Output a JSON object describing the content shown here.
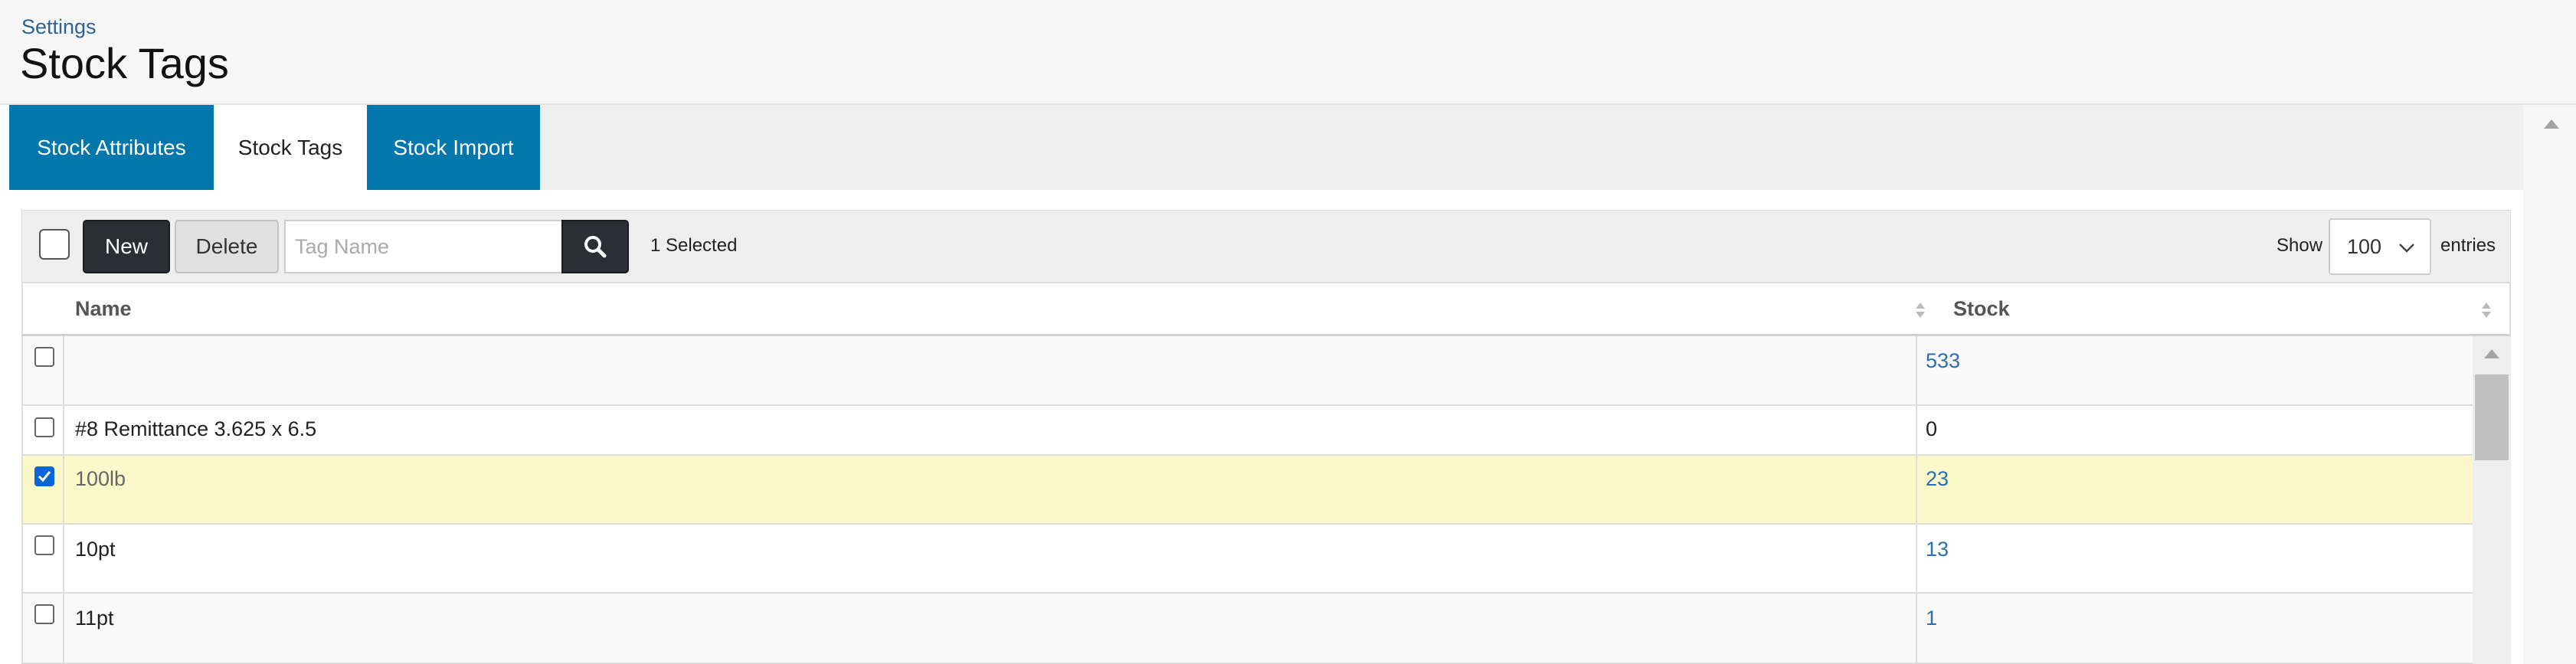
{
  "breadcrumb": "Settings",
  "page_title": "Stock Tags",
  "tabs": [
    {
      "label": "Stock Attributes",
      "active": false
    },
    {
      "label": "Stock Tags",
      "active": true
    },
    {
      "label": "Stock Import",
      "active": false
    }
  ],
  "toolbar": {
    "new_label": "New",
    "delete_label": "Delete",
    "search_placeholder": "Tag Name",
    "search_value": "",
    "selected_text": "1 Selected",
    "show_label": "Show",
    "entries_value": "100",
    "entries_label": "entries"
  },
  "table": {
    "columns": [
      "Name",
      "Stock"
    ],
    "rows": [
      {
        "name": "",
        "stock": "533",
        "checked": false
      },
      {
        "name": "#8 Remittance 3.625 x 6.5",
        "stock": "0",
        "checked": false
      },
      {
        "name": "100lb",
        "stock": "23",
        "checked": true
      },
      {
        "name": "10pt",
        "stock": "13",
        "checked": false
      },
      {
        "name": "11pt",
        "stock": "1",
        "checked": false
      }
    ]
  },
  "colors": {
    "tab_blue": "#0277ac",
    "dark_button": "#2b2f33",
    "link_blue": "#2a6fb0",
    "selected_row": "#fcf8c9",
    "checkbox_checked": "#0a66d6"
  },
  "icons": {
    "search": "search-icon",
    "sort": "sort-icon",
    "chevron": "chevron-down-icon",
    "check": "check-icon",
    "scroll_up": "scroll-up-icon"
  }
}
